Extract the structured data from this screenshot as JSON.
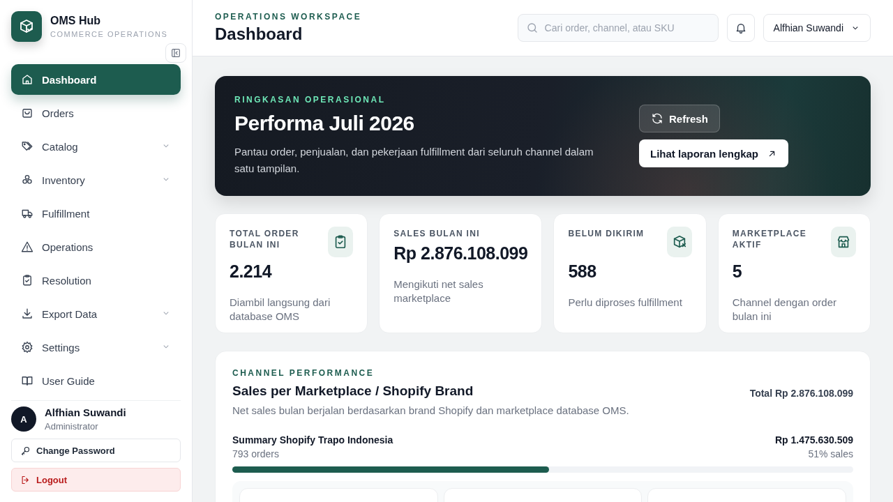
{
  "brand": {
    "name": "OMS Hub",
    "subtitle": "COMMERCE OPERATIONS"
  },
  "nav": [
    {
      "label": "Dashboard",
      "selected": true,
      "expandable": false
    },
    {
      "label": "Orders",
      "selected": false,
      "expandable": false
    },
    {
      "label": "Catalog",
      "selected": false,
      "expandable": true
    },
    {
      "label": "Inventory",
      "selected": false,
      "expandable": true
    },
    {
      "label": "Fulfillment",
      "selected": false,
      "expandable": false
    },
    {
      "label": "Operations",
      "selected": false,
      "expandable": false
    },
    {
      "label": "Resolution",
      "selected": false,
      "expandable": false
    },
    {
      "label": "Export Data",
      "selected": false,
      "expandable": true
    },
    {
      "label": "Settings",
      "selected": false,
      "expandable": true
    },
    {
      "label": "User Guide",
      "selected": false,
      "expandable": false
    }
  ],
  "user": {
    "initial": "A",
    "name": "Alfhian Suwandi",
    "role": "Administrator"
  },
  "account_actions": [
    {
      "label": "Change Password",
      "kind": "normal"
    },
    {
      "label": "Logout",
      "kind": "danger"
    }
  ],
  "header": {
    "eyebrow": "OPERATIONS WORKSPACE",
    "title": "Dashboard",
    "search": {
      "placeholder": "Cari order, channel, atau SKU"
    },
    "user_menu": "Alfhian Suwandi"
  },
  "hero": {
    "eyebrow": "RINGKASAN OPERASIONAL",
    "title": "Performa Juli 2026",
    "text": "Pantau order, penjualan, dan pekerjaan fulfillment dari seluruh channel dalam satu tampilan.",
    "refresh": "Refresh",
    "report": "Lihat laporan lengkap"
  },
  "stats": [
    {
      "label": "TOTAL ORDER BULAN INI",
      "value": "2.214",
      "note": "Diambil langsung dari database OMS"
    },
    {
      "label": "SALES BULAN INI",
      "value": "Rp 2.876.108.099",
      "note": "Mengikuti net sales marketplace"
    },
    {
      "label": "BELUM DIKIRIM",
      "value": "588",
      "note": "Perlu diproses fulfillment"
    },
    {
      "label": "MARKETPLACE AKTIF",
      "value": "5",
      "note": "Channel dengan order bulan ini"
    }
  ],
  "channel": {
    "eyebrow": "CHANNEL PERFORMANCE",
    "title": "Sales per Marketplace / Shopify Brand",
    "total": "Total Rp 2.876.108.099",
    "description": "Net sales bulan berjalan berdasarkan brand Shopify dan marketplace database OMS.",
    "rows": [
      {
        "name": "Summary Shopify Trapo Indonesia",
        "orders": "793 orders",
        "amount": "Rp 1.475.630.509",
        "share": "51% sales",
        "level": 0.51
      }
    ]
  }
}
